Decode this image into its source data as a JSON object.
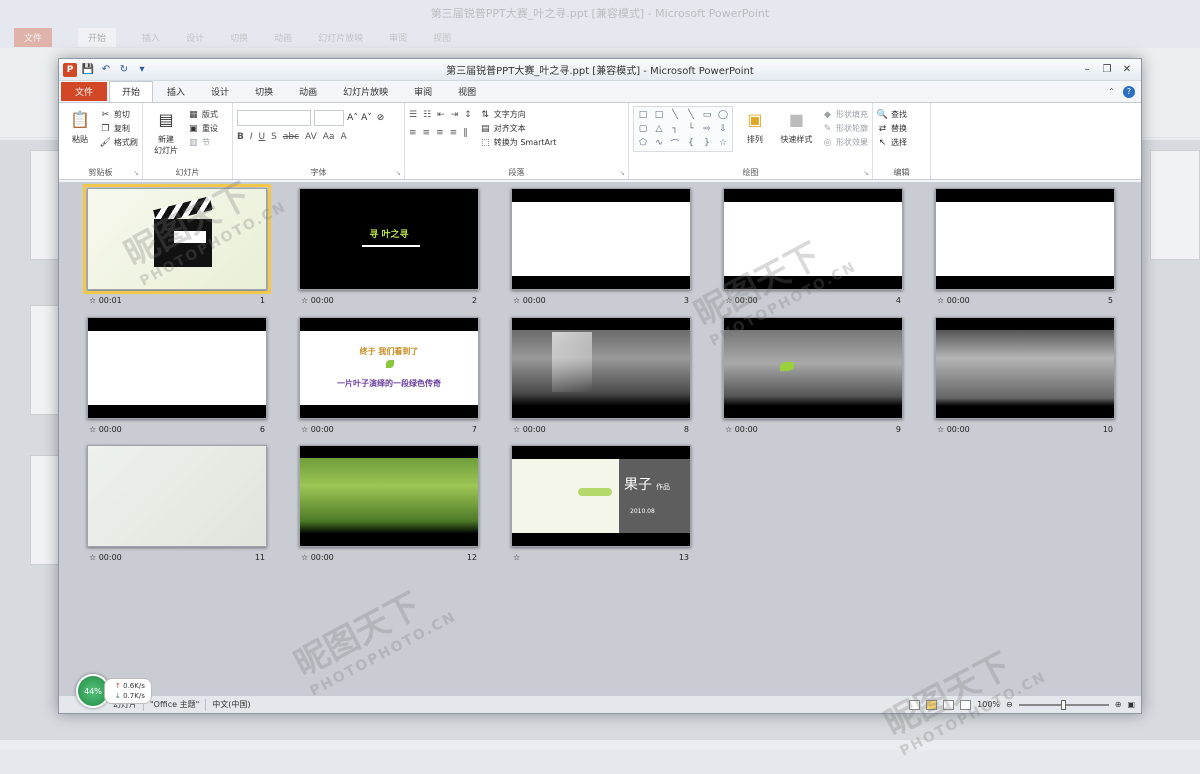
{
  "app": {
    "window_title": "第三届锐普PPT大赛_叶之寻.ppt [兼容模式] - Microsoft PowerPoint",
    "app_icon": "P"
  },
  "tabs": [
    {
      "label": "文件"
    },
    {
      "label": "开始"
    },
    {
      "label": "插入"
    },
    {
      "label": "设计"
    },
    {
      "label": "切换"
    },
    {
      "label": "动画"
    },
    {
      "label": "幻灯片放映"
    },
    {
      "label": "审阅"
    },
    {
      "label": "视图"
    }
  ],
  "ribbon": {
    "clipboard": {
      "paste": "粘贴",
      "cut": "剪切",
      "copy": "复制",
      "format_painter": "格式刷",
      "label": "剪贴板"
    },
    "slides": {
      "new_slide_1": "新建",
      "new_slide_2": "幻灯片",
      "layout": "版式",
      "reset": "重设",
      "section": "节",
      "label": "幻灯片"
    },
    "font": {
      "label": "字体"
    },
    "paragraph": {
      "text_direction": "文字方向",
      "align_text": "对齐文本",
      "smartart": "转换为 SmartArt",
      "label": "段落"
    },
    "drawing": {
      "arrange": "排列",
      "quick_styles": "快速样式",
      "fill": "形状填充",
      "outline": "形状轮廓",
      "effects": "形状效果",
      "label": "绘图"
    },
    "editing": {
      "find": "查找",
      "replace": "替换",
      "select": "选择",
      "label": "编辑"
    }
  },
  "slides": [
    {
      "number": "1",
      "time": "00:01"
    },
    {
      "number": "2",
      "time": "00:00",
      "text": "寻 叶之寻"
    },
    {
      "number": "3",
      "time": "00:00"
    },
    {
      "number": "4",
      "time": "00:00"
    },
    {
      "number": "5",
      "time": "00:00"
    },
    {
      "number": "6",
      "time": "00:00"
    },
    {
      "number": "7",
      "time": "00:00",
      "text_line1": "终于 我们看到了",
      "text_line2": "一片叶子演绎的一段绿色传奇"
    },
    {
      "number": "8",
      "time": "00:00"
    },
    {
      "number": "9",
      "time": "00:00"
    },
    {
      "number": "10",
      "time": "00:00"
    },
    {
      "number": "11",
      "time": "00:00"
    },
    {
      "number": "12",
      "time": "00:00"
    },
    {
      "number": "13",
      "time": "",
      "text_big": "果子",
      "text_small": "作品",
      "date": "2010.08"
    }
  ],
  "statusbar": {
    "view_label": "幻灯片",
    "theme": "\"Office 主题\"",
    "language": "中文(中国)",
    "zoom": "100%"
  },
  "net_widget": {
    "percent": "44%",
    "up": "0.6K/s",
    "down": "0.7K/s"
  },
  "watermark": {
    "brand": "昵图天下",
    "url": "PHOTOPHOTO.CN"
  }
}
